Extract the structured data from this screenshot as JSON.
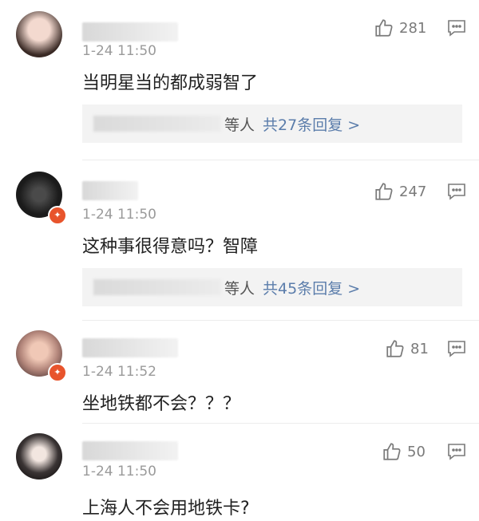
{
  "comments": [
    {
      "time": "1-24 11:50",
      "text": "当明星当的都成弱智了",
      "likes": "281",
      "has_badge": false,
      "reply": {
        "suffix": "等人",
        "link": "共27条回复 >"
      }
    },
    {
      "time": "1-24 11:50",
      "text": "这种事很得意吗？智障",
      "likes": "247",
      "has_badge": true,
      "reply": {
        "suffix": "等人",
        "link": "共45条回复 >"
      }
    },
    {
      "time": "1-24 11:52",
      "text": "坐地铁都不会？？？",
      "likes": "81",
      "has_badge": true,
      "reply": null
    },
    {
      "time": "1-24 11:50",
      "text": "上海人不会用地铁卡?",
      "likes": "50",
      "has_badge": false,
      "reply": null
    }
  ],
  "icons": {
    "like": "thumbs-up-icon",
    "menu": "comment-menu-icon",
    "badge": "verified-badge-icon"
  },
  "colors": {
    "link": "#5b7dab",
    "badge": "#e8542c",
    "meta": "#9a9a9a"
  }
}
